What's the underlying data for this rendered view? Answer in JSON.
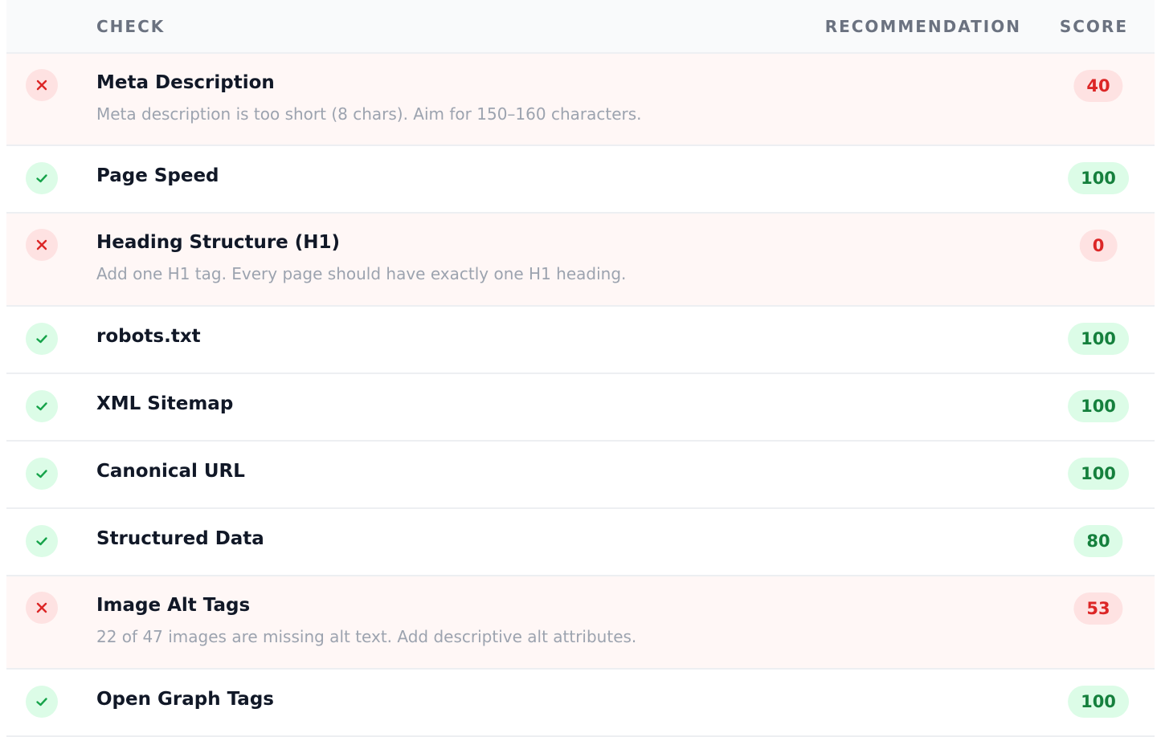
{
  "header": {
    "check": "CHECK",
    "recommendation": "RECOMMENDATION",
    "score": "SCORE"
  },
  "colors": {
    "pass_bg": "#dcfce7",
    "pass_fg": "#15803d",
    "fail_bg": "#fee2e2",
    "fail_fg": "#dc2626",
    "fail_row_bg": "#fff7f6"
  },
  "rows": [
    {
      "status": "fail",
      "icon": "x-icon",
      "title": "Meta Description",
      "desc": "Meta description is too short (8 chars). Aim for 150–160 characters.",
      "score": "40"
    },
    {
      "status": "pass",
      "icon": "check-icon",
      "title": "Page Speed",
      "desc": "",
      "score": "100"
    },
    {
      "status": "fail",
      "icon": "x-icon",
      "title": "Heading Structure (H1)",
      "desc": "Add one H1 tag. Every page should have exactly one H1 heading.",
      "score": "0"
    },
    {
      "status": "pass",
      "icon": "check-icon",
      "title": "robots.txt",
      "desc": "",
      "score": "100"
    },
    {
      "status": "pass",
      "icon": "check-icon",
      "title": "XML Sitemap",
      "desc": "",
      "score": "100"
    },
    {
      "status": "pass",
      "icon": "check-icon",
      "title": "Canonical URL",
      "desc": "",
      "score": "100"
    },
    {
      "status": "pass",
      "icon": "check-icon",
      "title": "Structured Data",
      "desc": "",
      "score": "80"
    },
    {
      "status": "fail",
      "icon": "x-icon",
      "title": "Image Alt Tags",
      "desc": "22 of 47 images are missing alt text. Add descriptive alt attributes.",
      "score": "53"
    },
    {
      "status": "pass",
      "icon": "check-icon",
      "title": "Open Graph Tags",
      "desc": "",
      "score": "100"
    }
  ]
}
